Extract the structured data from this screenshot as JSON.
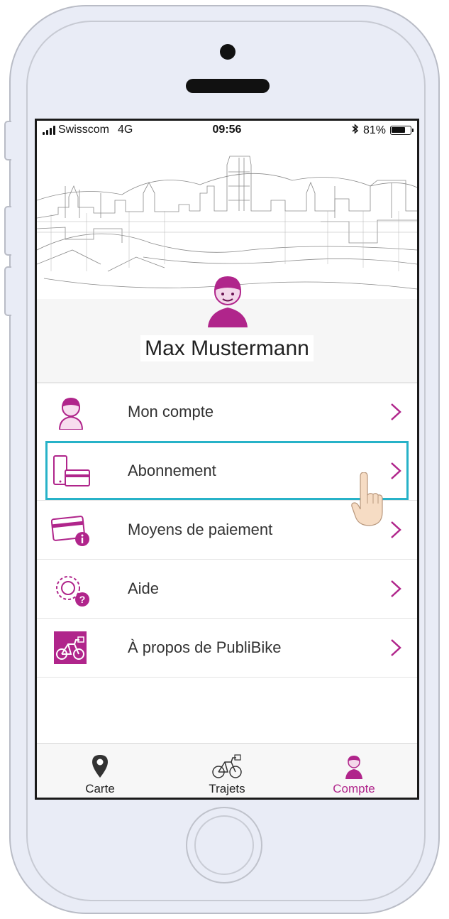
{
  "status_bar": {
    "carrier": "Swisscom",
    "network": "4G",
    "time": "09:56",
    "battery_percent": "81%",
    "battery_level": 0.81,
    "icons": [
      "signal-icon",
      "bluetooth-icon",
      "battery-icon"
    ]
  },
  "profile": {
    "name": "Max Mustermann",
    "avatar": "cyclist-helmet-icon"
  },
  "menu": {
    "items": [
      {
        "label": "Mon compte",
        "icon": "user-account-icon"
      },
      {
        "label": "Abonnement",
        "icon": "phone-card-icon"
      },
      {
        "label": "Moyens de paiement",
        "icon": "credit-card-info-icon"
      },
      {
        "label": "Aide",
        "icon": "gear-help-icon"
      },
      {
        "label": "À propos de PubliBike",
        "icon": "bike-icon"
      }
    ]
  },
  "tabbar": {
    "tabs": [
      {
        "label": "Carte",
        "icon": "map-pin-icon",
        "active": false
      },
      {
        "label": "Trajets",
        "icon": "bike-icon",
        "active": false
      },
      {
        "label": "Compte",
        "icon": "cyclist-avatar-icon",
        "active": true
      }
    ]
  },
  "colors": {
    "brand": "#b0258b",
    "highlight": "#27b2c8",
    "phone_frame": "#e9ecf6"
  }
}
